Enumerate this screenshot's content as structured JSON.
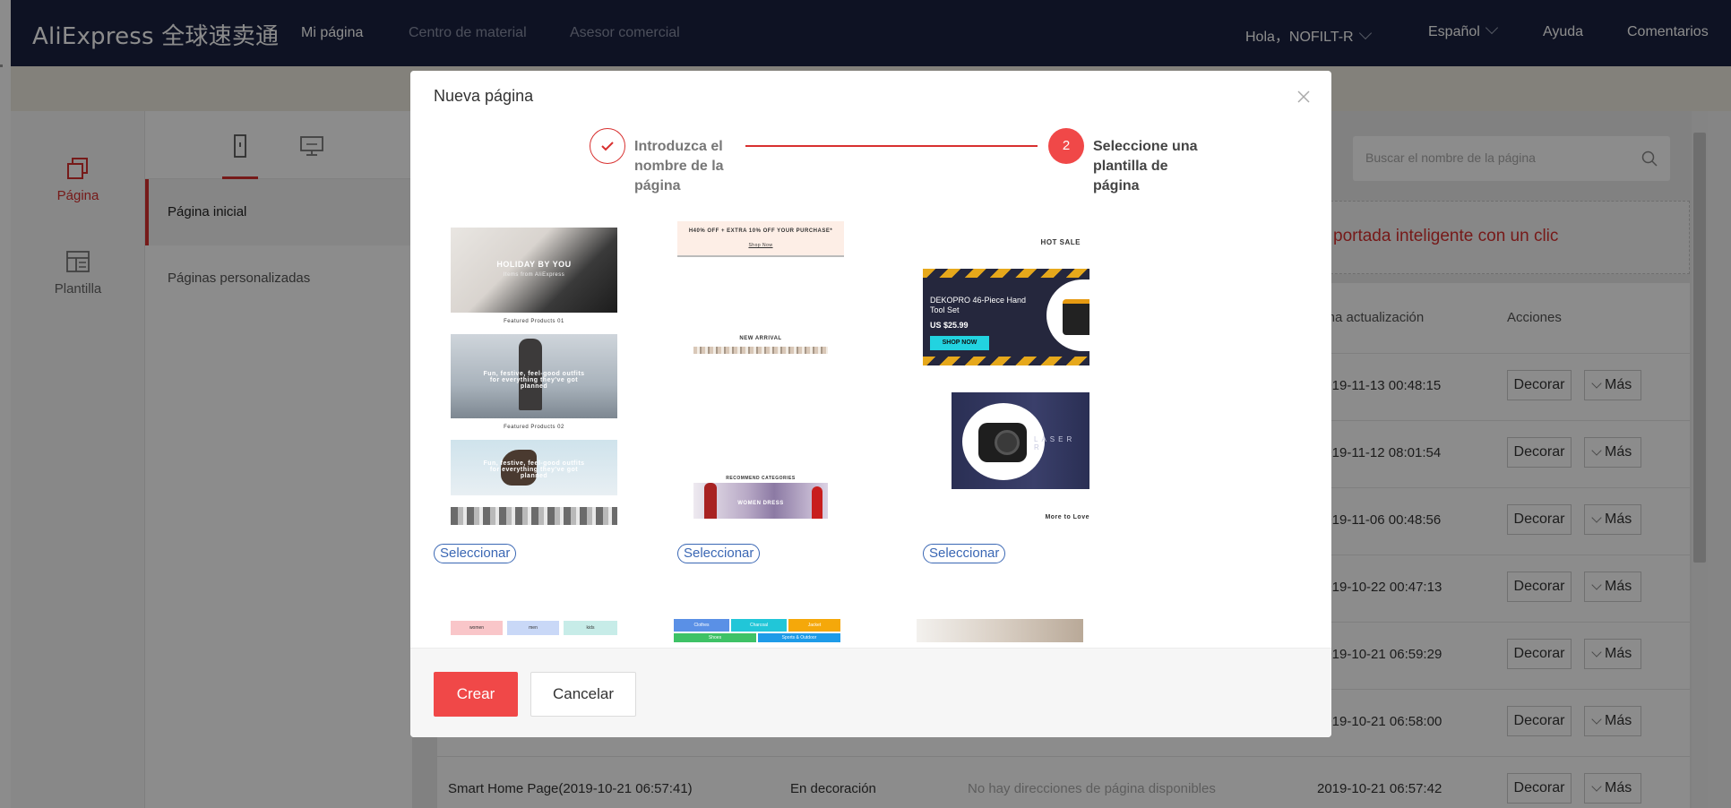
{
  "header": {
    "logo": "AliExpress 全球速卖通",
    "nav": [
      "Mi página",
      "Centro de material",
      "Asesor comercial"
    ],
    "greeting": "Hola，NOFILT-R",
    "language": "Español",
    "help": "Ayuda",
    "comments": "Comentarios"
  },
  "sidebar": {
    "items": [
      {
        "label": "Página",
        "icon": "pages-icon"
      },
      {
        "label": "Plantilla",
        "icon": "template-icon"
      }
    ]
  },
  "subpanel": {
    "devices": [
      "mobile-icon",
      "desktop-icon"
    ],
    "items": [
      "Página inicial",
      "Páginas personalizadas"
    ]
  },
  "main": {
    "search_placeholder": "Buscar el nombre de la página",
    "banner": "portada inteligente con un clic",
    "columns": [
      "tima actualización",
      "Acciones"
    ],
    "rows": [
      {
        "date": "2019-11-13 00:48:15"
      },
      {
        "date": "2019-11-12 08:01:54"
      },
      {
        "date": "2019-11-06 00:48:56"
      },
      {
        "date": "2019-10-22 00:47:13"
      },
      {
        "date": "2019-10-21 06:59:29"
      },
      {
        "date": "2019-10-21 06:58:00"
      }
    ],
    "last_row": {
      "name": "Smart Home Page(2019-10-21 06:57:41)",
      "status": "En decoración",
      "address": "No hay direcciones de página disponibles",
      "date": "2019-10-21 06:57:42"
    },
    "decorate_label": "Decorar",
    "more_label": "Más"
  },
  "modal": {
    "title": "Nueva página",
    "steps": [
      {
        "label": "Introduzca el nombre de la página",
        "state": "done"
      },
      {
        "label": "Seleccione una plantilla de página",
        "number": "2",
        "state": "current"
      }
    ],
    "select_label": "Seleccionar",
    "thumbs": {
      "t1": {
        "hero": "HOLIDAY BY YOU",
        "sub": "Items from AliExpress",
        "fp1": "Featured Products 01",
        "fun": "Fun, festive, feel-good outfits for everything they've got planned",
        "fp2": "Featured Products 02",
        "fun2": "Fun, festive, feel-good outfits for everything they've got planned"
      },
      "t2": {
        "promo": "H40% OFF + EXTRA 10% OFF YOUR PURCHASE*",
        "promo_sub": "Shop Now",
        "arrival": "NEW ARRIVAL",
        "cats": "RECOMMEND CATEGORIES",
        "dress": "WOMEN DRESS"
      },
      "t3": {
        "hot": "HOT SALE",
        "product": "DEKOPRO 46-Piece Hand Tool Set",
        "price": "US $25.99",
        "shop": "SHOP NOW",
        "laser": "LASER R",
        "more": "More to Love"
      },
      "t4": {
        "tags": [
          "women",
          "men",
          "kids"
        ]
      },
      "t5": {
        "tags": [
          "Clothes",
          "Charcoal",
          "Jacket",
          "Shoes",
          "Sports & Outdoor"
        ]
      }
    },
    "create_label": "Crear",
    "cancel_label": "Cancelar"
  },
  "colors": {
    "header_bg": "#1a2240",
    "accent_red": "#d8302f",
    "primary_btn": "#f04848",
    "link_blue": "#3a67b4"
  }
}
